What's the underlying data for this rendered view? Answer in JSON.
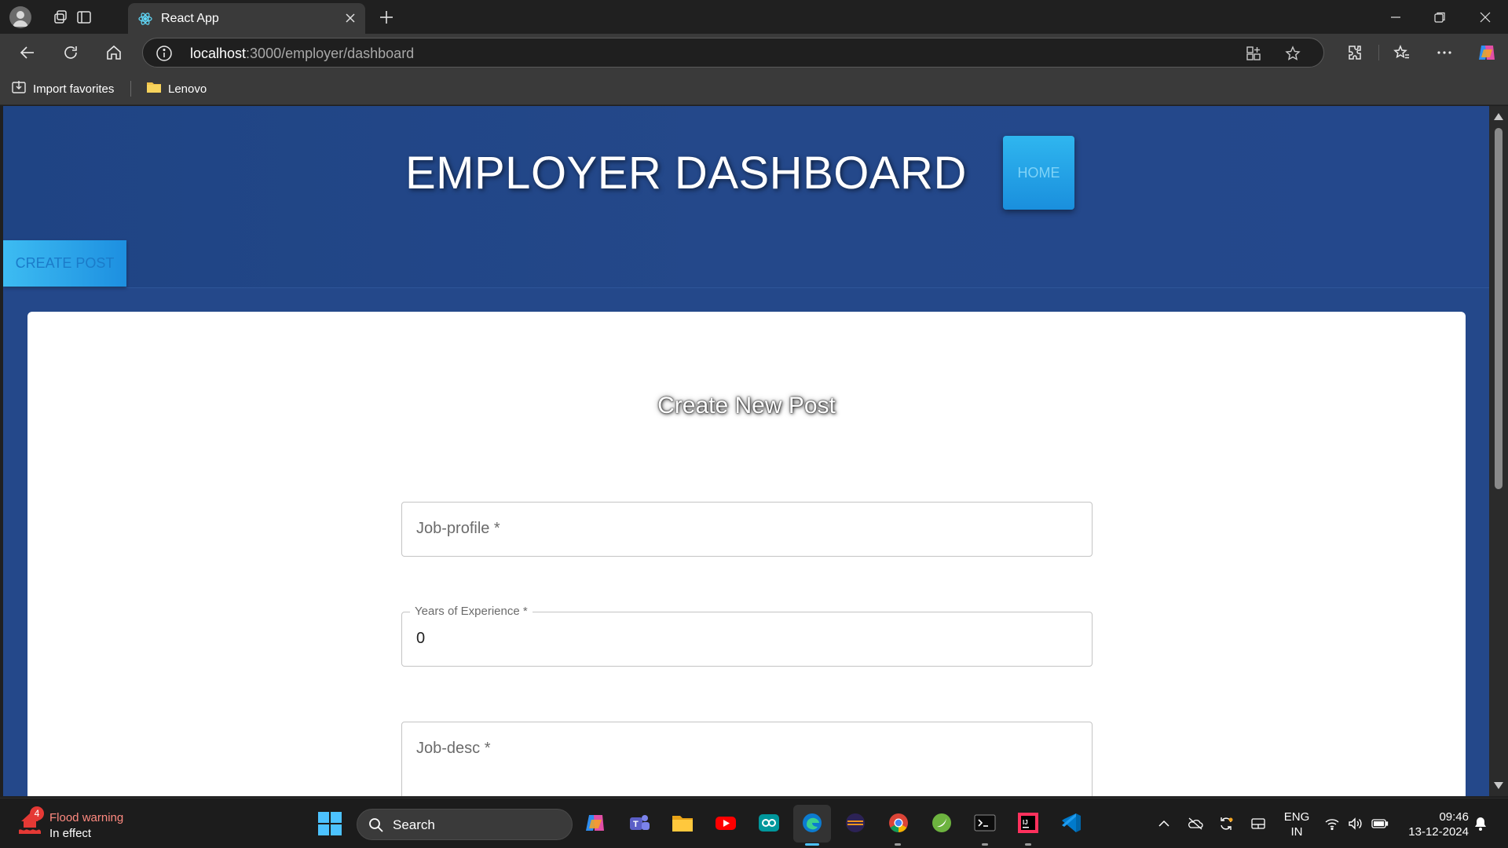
{
  "browser": {
    "tab_title": "React App",
    "address_host": "localhost",
    "address_path": ":3000/employer/dashboard",
    "bookmarks": [
      {
        "label": "Import favorites"
      },
      {
        "label": "Lenovo"
      }
    ]
  },
  "page": {
    "header_title": "EMPLOYER DASHBOARD",
    "home_button": "HOME",
    "create_post_button": "CREATE POST",
    "form_title": "Create New Post",
    "fields": {
      "job_profile": {
        "label": "Job-profile *",
        "value": ""
      },
      "experience": {
        "label": "Years of Experience *",
        "value": "0"
      },
      "job_desc": {
        "label": "Job-desc *",
        "value": ""
      }
    },
    "colors": {
      "background": "#24488a",
      "button_accent": "#2fb6ef",
      "card": "#ffffff"
    }
  },
  "taskbar": {
    "weather_badge": "4",
    "weather_title": "Flood warning",
    "weather_subtitle": "In effect",
    "search_placeholder": "Search",
    "language_line1": "ENG",
    "language_line2": "IN",
    "time": "09:46",
    "date": "13-12-2024"
  }
}
